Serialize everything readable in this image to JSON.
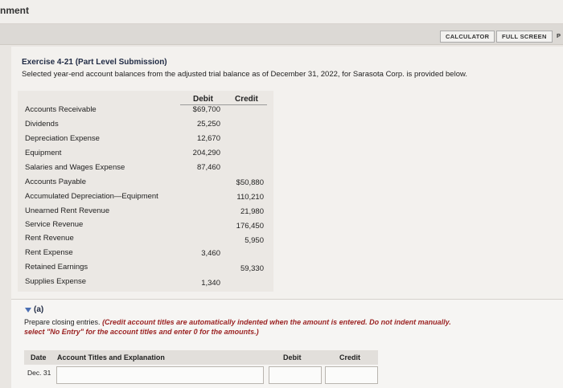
{
  "window": {
    "title": "nment"
  },
  "toolbar": {
    "calculator": "CALCULATOR",
    "full_screen": "FULL SCREEN",
    "edge_letter": "P"
  },
  "exercise": {
    "title": "Exercise 4-21 (Part Level Submission)",
    "description": "Selected year-end account balances from the adjusted trial balance as of December 31, 2022, for Sarasota Corp. is provided below."
  },
  "table": {
    "headers": {
      "debit": "Debit",
      "credit": "Credit"
    },
    "rows": [
      {
        "account": "Accounts Receivable",
        "debit": "$69,700",
        "credit": ""
      },
      {
        "account": "Dividends",
        "debit": "25,250",
        "credit": ""
      },
      {
        "account": "Depreciation Expense",
        "debit": "12,670",
        "credit": ""
      },
      {
        "account": "Equipment",
        "debit": "204,290",
        "credit": ""
      },
      {
        "account": "Salaries and Wages Expense",
        "debit": "87,460",
        "credit": ""
      },
      {
        "account": "Accounts Payable",
        "debit": "",
        "credit": "$50,880"
      },
      {
        "account": "Accumulated Depreciation—Equipment",
        "debit": "",
        "credit": "110,210"
      },
      {
        "account": "Unearned Rent Revenue",
        "debit": "",
        "credit": "21,980"
      },
      {
        "account": "Service Revenue",
        "debit": "",
        "credit": "176,450"
      },
      {
        "account": "Rent Revenue",
        "debit": "",
        "credit": "5,950"
      },
      {
        "account": "Rent Expense",
        "debit": "3,460",
        "credit": ""
      },
      {
        "account": "Retained Earnings",
        "debit": "",
        "credit": "59,330"
      },
      {
        "account": "Supplies Expense",
        "debit": "1,340",
        "credit": ""
      }
    ]
  },
  "part_a": {
    "label": "(a)",
    "instruction_plain": "Prepare closing entries. ",
    "instruction_italic": "(Credit account titles are automatically indented when the amount is entered. Do not indent manually.",
    "instruction_line2": "select \"No Entry\" for the account titles and enter 0 for the amounts.)",
    "journal_headers": {
      "date": "Date",
      "account": "Account Titles and Explanation",
      "debit": "Debit",
      "credit": "Credit"
    },
    "first_row_date": "Dec. 31"
  }
}
